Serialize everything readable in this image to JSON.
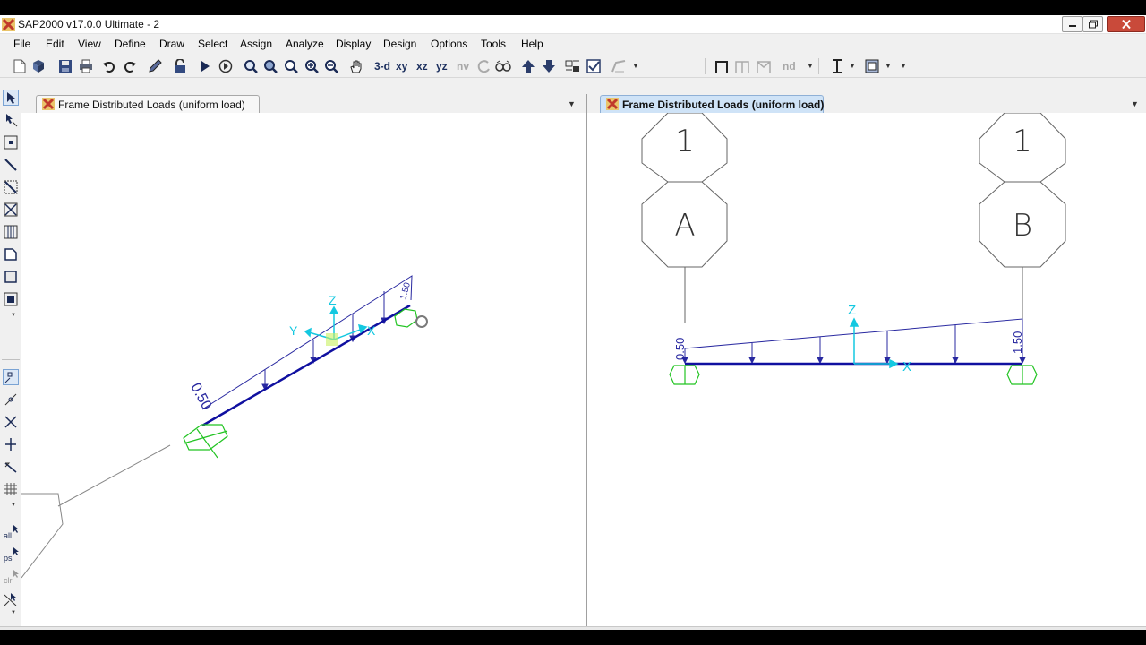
{
  "window": {
    "title": "SAP2000 v17.0.0 Ultimate  - 2",
    "icon": "sap2000-x-icon"
  },
  "menu": [
    "File",
    "Edit",
    "View",
    "Define",
    "Draw",
    "Select",
    "Assign",
    "Analyze",
    "Display",
    "Design",
    "Options",
    "Tools",
    "Help"
  ],
  "toolbar": {
    "view_3d": "3-d",
    "view_xy": "xy",
    "view_xz": "xz",
    "view_yz": "yz",
    "view_nv": "nv",
    "nd": "nd"
  },
  "vtoolbar": {
    "all": "all",
    "ps": "ps",
    "clr": "clr"
  },
  "panes": {
    "left": {
      "tab_title": "Frame Distributed Loads (uniform load)",
      "active": false,
      "load_start": "0.50",
      "load_end": "1.50",
      "axis_x": "X",
      "axis_y": "Y",
      "axis_z": "Z"
    },
    "right": {
      "tab_title": "Frame Distributed Loads (uniform load)",
      "active": true,
      "grid_top_left": "1",
      "grid_top_right": "1",
      "grid_left": "A",
      "grid_right": "B",
      "load_start": "0.50",
      "load_end": "1.50",
      "axis_x": "X",
      "axis_z": "Z"
    }
  },
  "colors": {
    "frame": "#1010a0",
    "load": "#2828a0",
    "support": "#22c422",
    "axis": "#14c8e0",
    "grid": "#666666"
  }
}
